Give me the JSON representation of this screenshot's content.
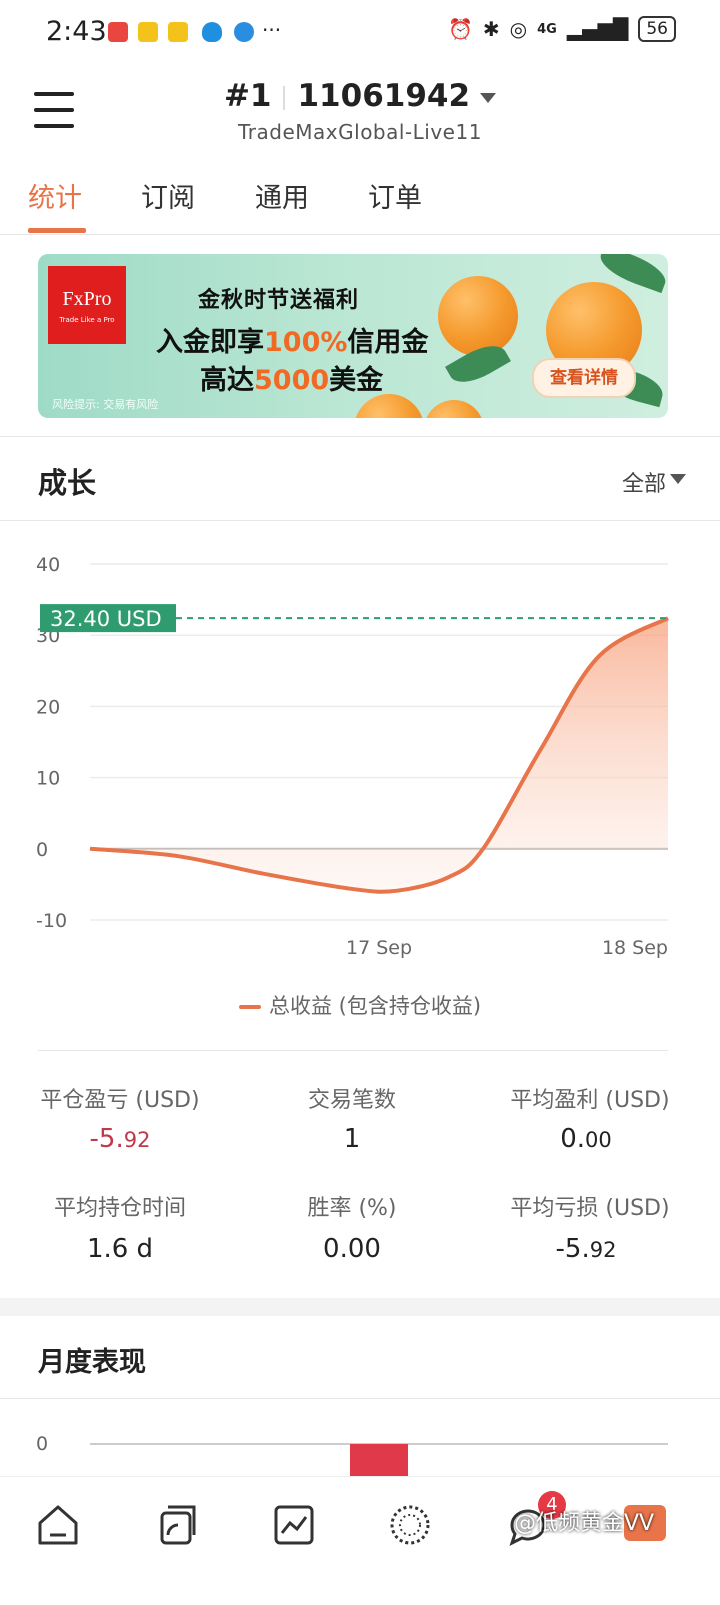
{
  "status_bar": {
    "time": "2:43",
    "more": "···",
    "network": "4G",
    "battery": "56"
  },
  "header": {
    "account_prefix": "#1",
    "account_number": "11061942",
    "server": "TradeMaxGlobal-Live11"
  },
  "tabs": [
    {
      "label": "统计",
      "active": true
    },
    {
      "label": "订阅",
      "active": false
    },
    {
      "label": "通用",
      "active": false
    },
    {
      "label": "订单",
      "active": false
    }
  ],
  "banner": {
    "logo": "FxPro",
    "logo_tagline": "Trade Like a Pro",
    "line1": "金秋时节送福利",
    "line2_pre": "入金即享",
    "line2_hl": "100%",
    "line2_post": "信用金",
    "line3_pre": "高达",
    "line3_hl": "5000",
    "line3_post": "美金",
    "risk_note": "风险提示: 交易有风险",
    "cta": "查看详情"
  },
  "growth": {
    "title": "成长",
    "filter": "全部",
    "current_value_label": "32.40 USD",
    "legend": "总收益 (包含持仓收益)"
  },
  "chart_data": {
    "type": "area",
    "x_ticks": [
      "17 Sep",
      "18 Sep"
    ],
    "y_ticks": [
      40,
      30,
      20,
      10,
      0,
      -10
    ],
    "ylim": [
      -10,
      40
    ],
    "points": [
      {
        "x": 0.0,
        "y": 0
      },
      {
        "x": 0.15,
        "y": -1
      },
      {
        "x": 0.3,
        "y": -3.5
      },
      {
        "x": 0.45,
        "y": -5.6
      },
      {
        "x": 0.53,
        "y": -5.9
      },
      {
        "x": 0.62,
        "y": -4
      },
      {
        "x": 0.68,
        "y": 0
      },
      {
        "x": 0.78,
        "y": 14
      },
      {
        "x": 0.88,
        "y": 27
      },
      {
        "x": 1.0,
        "y": 32.4
      }
    ],
    "series": [
      {
        "name": "总收益 (包含持仓收益)",
        "color": "#e8744a"
      }
    ],
    "marker_value": 32.4,
    "marker_color": "#2e9c6e"
  },
  "stats": [
    {
      "label": "平仓盈亏 (USD)",
      "value_main": "-5.",
      "value_small": "92",
      "negative": true
    },
    {
      "label": "交易笔数",
      "value_main": "1",
      "value_small": "",
      "negative": false
    },
    {
      "label": "平均盈利 (USD)",
      "value_main": "0.",
      "value_small": "00",
      "negative": false
    },
    {
      "label": "平均持仓时间",
      "value_main": "1.6 d",
      "value_small": "",
      "negative": false
    },
    {
      "label": "胜率 (%)",
      "value_main": "0.00",
      "value_small": "",
      "negative": false
    },
    {
      "label": "平均亏损 (USD)",
      "value_main": "-5.",
      "value_small": "92",
      "negative": false
    }
  ],
  "monthly": {
    "title": "月度表现",
    "y_tick": "0",
    "bar_color": "#e0394a"
  },
  "bottom_nav": {
    "badge": "4",
    "watermark": "@低频黄金VV"
  },
  "colors": {
    "accent": "#e8744a",
    "marker": "#2e9c6e",
    "negative": "#c0394a"
  }
}
